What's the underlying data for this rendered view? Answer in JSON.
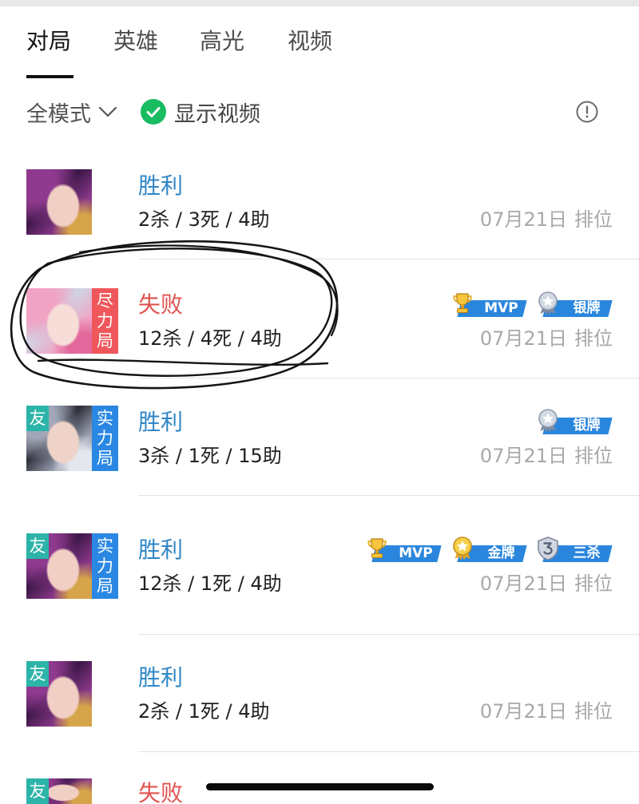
{
  "tabs": [
    {
      "label": "对局",
      "active": true
    },
    {
      "label": "英雄",
      "active": false
    },
    {
      "label": "高光",
      "active": false
    },
    {
      "label": "视频",
      "active": false
    }
  ],
  "filter": {
    "mode_label": "全模式",
    "mode_icon": "chevron-down-icon",
    "show_video_label": "显示视频",
    "show_video_checked": true,
    "show_video_icon": "check-circle-icon",
    "info_icon": "info-icon"
  },
  "colors": {
    "win": "#2f86c7",
    "loss": "#e0524f",
    "badge": "#2a86dd",
    "friend_tag": "#2cb4a8",
    "check": "#1abc62",
    "text_primary": "#222222",
    "text_secondary": "#a8a8a8"
  },
  "matches": [
    {
      "result": "胜利",
      "result_color": "#2f86c7",
      "stats": "2杀 / 3死 / 4助",
      "date": "07月21日",
      "mode": "排位",
      "avatar_colors": [
        "#3d1748",
        "#8f3a8e",
        "#d6a54a",
        "#f1cfc4"
      ],
      "badges": []
    },
    {
      "result": "失败",
      "result_color": "#e0524f",
      "stats": "12杀 / 4死 / 4助",
      "date": "07月21日",
      "mode": "排位",
      "side_tag": {
        "label": "尽力局",
        "color": "#f0575b"
      },
      "avatar_colors": [
        "#cfd5e4",
        "#f1a3c4",
        "#e3679b",
        "#f6ddd7"
      ],
      "badges": [
        {
          "label": "MVP",
          "icon": "trophy-icon"
        },
        {
          "label": "银牌",
          "icon": "silver-medal-icon"
        }
      ]
    },
    {
      "result": "胜利",
      "result_color": "#2f86c7",
      "stats": "3杀 / 1死 / 15助",
      "date": "07月21日",
      "mode": "排位",
      "friend_tag": "友",
      "side_tag": {
        "label": "实力局",
        "color": "#2a88e4"
      },
      "avatar_colors": [
        "#2d2e3a",
        "#a1a7b8",
        "#e4e7ee",
        "#efd3c9"
      ],
      "badges": [
        {
          "label": "银牌",
          "icon": "silver-medal-icon"
        }
      ]
    },
    {
      "result": "胜利",
      "result_color": "#2f86c7",
      "stats": "12杀 / 1死 / 4助",
      "date": "07月21日",
      "mode": "排位",
      "friend_tag": "友",
      "side_tag": {
        "label": "实力局",
        "color": "#2a88e4"
      },
      "avatar_colors": [
        "#3d1748",
        "#8f3a8e",
        "#d6a54a",
        "#f1cfc4"
      ],
      "badges": [
        {
          "label": "MVP",
          "icon": "trophy-icon"
        },
        {
          "label": "金牌",
          "icon": "gold-medal-icon"
        },
        {
          "label": "三杀",
          "icon": "triple-kill-icon"
        }
      ]
    },
    {
      "result": "胜利",
      "result_color": "#2f86c7",
      "stats": "2杀 / 1死 / 4助",
      "date": "07月21日",
      "mode": "排位",
      "friend_tag": "友",
      "avatar_colors": [
        "#3d1748",
        "#8f3a8e",
        "#d6a54a",
        "#f1cfc4"
      ],
      "badges": []
    },
    {
      "result": "失败",
      "result_color": "#e0524f",
      "friend_tag": "友",
      "avatar_colors": [
        "#3d1748",
        "#8f3a8e",
        "#d6a54a",
        "#f1cfc4"
      ],
      "badges": []
    }
  ]
}
